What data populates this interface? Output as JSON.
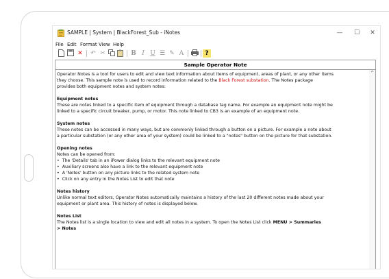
{
  "window": {
    "title": "SAMPLE | System | BlackForest_Sub - iNotes",
    "minimize": "—",
    "maximize": "☐",
    "close": "✕"
  },
  "menu": [
    "File",
    "Edit",
    "Format",
    "View",
    "Help"
  ],
  "toolbar": {
    "bold": "B",
    "italic": "I",
    "underline": "U",
    "font": "A",
    "help": "?"
  },
  "note": {
    "heading": "Sample Operator Note",
    "intro_1": "Operator Notes is a tool for users to edit and view text information about items of equipment, areas of plant, or any other items",
    "intro_2a": "they choose.  This sample note is used to record information related to the ",
    "intro_2_link": "Black Forest substation",
    "intro_2b": ".  The Notes package",
    "intro_3": "provides both equipment notes and system notes:",
    "equip_title": "Equipment notes",
    "equip_1": "These are notes linked to a specific item of equipment through a database tag name. For example an equipment note might be",
    "equip_2": "linked to a specific circuit breaker, pump, or motor.  This note linked to CB3 is an example of an equipment note.",
    "system_title": "System notes",
    "system_1": "These notes can be accessed in many ways, but are commonly linked through a button on a picture. For example a note about",
    "system_2": "a particular substation (or any other area of your system) could be linked to a \"notes\" button on the picture for that substation.",
    "opening_title": "Opening notes",
    "opening_intro": "Notes can be opened from:",
    "opening_items": [
      "The 'Details' tab in an iPower dialog links to the relevant equipment note",
      "Auxiliary screens also have a link to the relevant equipment note",
      "A 'Notes' button on any picture links to the related system note",
      "Click on any entry in the Notes List to edit that note"
    ],
    "history_title": "Notes history",
    "history_1": "Unlike normal text editors, Operator Notes automatically maintains a history of the last 20 different notes made about your",
    "history_2": "equipment or plant area.  This history of notes is displayed below.",
    "list_title": "Notes List",
    "list_1a": "The Notes list is a single location to view and edit all notes in a system.    To open the Notes List click ",
    "list_1b": "MENU > Summaries",
    "list_2": "> Notes"
  }
}
